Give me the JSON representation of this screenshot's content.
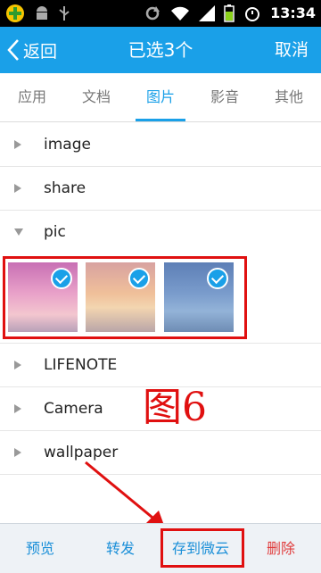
{
  "status_bar": {
    "time": "13:34"
  },
  "header": {
    "back_label": "返回",
    "title": "已选3个",
    "cancel_label": "取消"
  },
  "tabs": [
    {
      "label": "应用",
      "active": false
    },
    {
      "label": "文档",
      "active": false
    },
    {
      "label": "图片",
      "active": true
    },
    {
      "label": "影音",
      "active": false
    },
    {
      "label": "其他",
      "active": false
    }
  ],
  "folders": [
    {
      "name": "image",
      "expanded": false
    },
    {
      "name": "share",
      "expanded": false
    },
    {
      "name": "pic",
      "expanded": true
    },
    {
      "name": "LIFENOTE",
      "expanded": false
    },
    {
      "name": "Camera",
      "expanded": false
    },
    {
      "name": "wallpaper",
      "expanded": false
    }
  ],
  "selected_count": 3,
  "annotation": "图6",
  "bottom_bar": {
    "preview_label": "预览",
    "forward_label": "转发",
    "save_cloud_label": "存到微云",
    "delete_label": "删除"
  },
  "colors": {
    "accent": "#1aa0e8",
    "annotation_red": "#e01010",
    "delete_red": "#e03b3b"
  }
}
